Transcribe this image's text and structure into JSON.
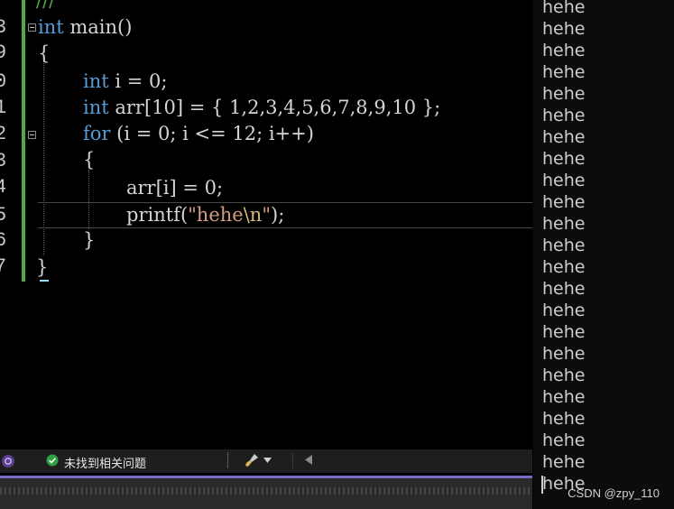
{
  "editor": {
    "gutter": [
      "3",
      "9",
      "0",
      "1",
      "2",
      "3",
      "4",
      "5",
      "6",
      "7"
    ],
    "top_comment": "///",
    "lines": [
      {
        "kw": "int",
        "rest": " main()"
      },
      {
        "text": "{"
      },
      {
        "kw": "int",
        "rest": " i = 0;"
      },
      {
        "kw": "int",
        "rest": " arr[10] = { 1,2,3,4,5,6,7,8,9,10 };"
      },
      {
        "kw": "for",
        "rest": " (i = 0; i <= 12; i++)"
      },
      {
        "text": "{"
      },
      {
        "text": "arr[i] = 0;"
      },
      {
        "fn": "printf",
        "open": "(",
        "str1": "\"hehe",
        "esc": "\\n",
        "str2": "\"",
        "close": ");"
      },
      {
        "text": "}"
      },
      {
        "text": "}"
      }
    ]
  },
  "statusbar": {
    "status_text": "未找到相关问题",
    "status_icon": "check-circle-icon",
    "brush_icon": "brush-icon",
    "dropdown_icon": "chevron-down-icon",
    "left_arrow_icon": "triangle-left-icon",
    "colors": {
      "ok": "#2ea043",
      "accent": "#7b68c9"
    }
  },
  "console": {
    "lines": [
      "hehe",
      "hehe",
      "hehe",
      "hehe",
      "hehe",
      "hehe",
      "hehe",
      "hehe",
      "hehe",
      "hehe",
      "hehe",
      "hehe",
      "hehe",
      "hehe",
      "hehe",
      "hehe",
      "hehe",
      "hehe",
      "hehe",
      "hehe",
      "hehe",
      "hehe",
      "hehe"
    ],
    "watermark": "CSDN @zpy_110"
  }
}
